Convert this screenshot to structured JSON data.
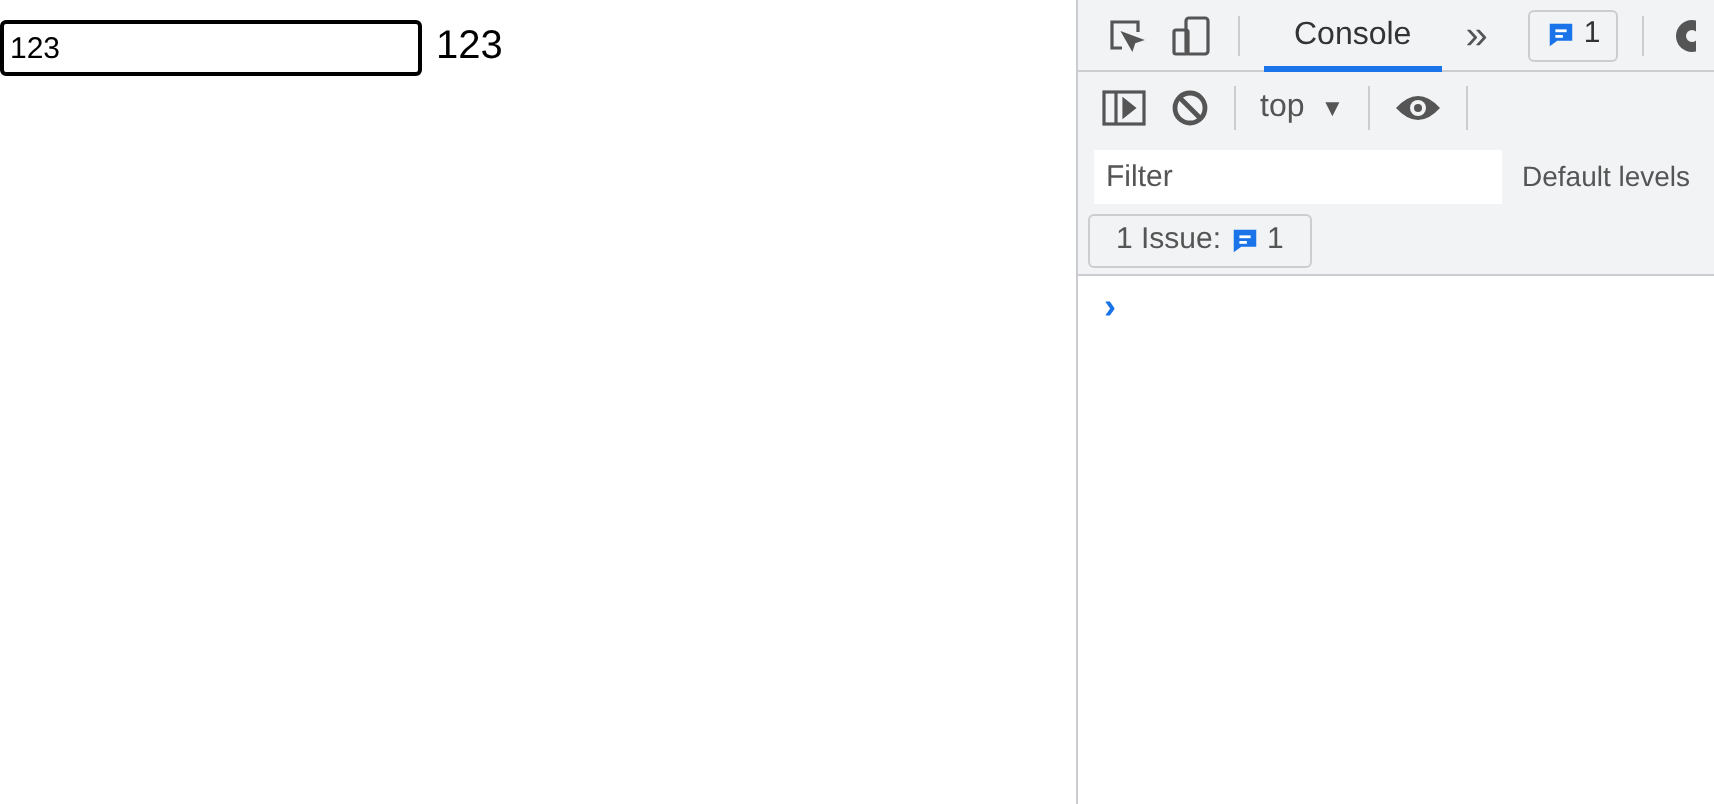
{
  "page": {
    "input": {
      "value": "123"
    },
    "output": "123"
  },
  "devtools": {
    "tabs": [
      {
        "label": "Console",
        "selected": true
      }
    ],
    "more": "»",
    "issues_badge": "1",
    "context": "top",
    "dropdown_caret": "▼",
    "filter": {
      "placeholder": "Filter"
    },
    "levels": "Default levels",
    "issues": {
      "label": "1 Issue:",
      "count": "1"
    },
    "prompt": "›"
  }
}
